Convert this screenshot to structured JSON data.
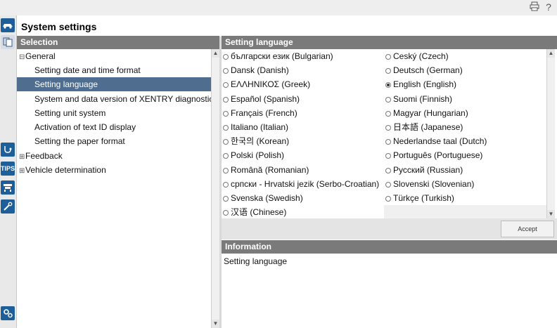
{
  "toolbar": {
    "print_icon": "printer-icon",
    "help_label": "?"
  },
  "rail": {
    "tips_label": "TIPS"
  },
  "page_title": "System settings",
  "selection": {
    "header": "Selection",
    "items": [
      {
        "label": "General",
        "expander": "⊟"
      },
      {
        "label": "Setting date and time format"
      },
      {
        "label": "Setting language"
      },
      {
        "label": "System and data version of XENTRY diagnostics"
      },
      {
        "label": "Setting unit system"
      },
      {
        "label": "Activation of text ID display"
      },
      {
        "label": "Setting the paper format"
      },
      {
        "label": "Feedback",
        "expander": "⊞"
      },
      {
        "label": "Vehicle determination",
        "expander": "⊞"
      }
    ]
  },
  "language": {
    "header": "Setting language",
    "left": [
      "български език (Bulgarian)",
      "Dansk (Danish)",
      "ΕΛΛΗΝΙΚΟΣ (Greek)",
      "Español (Spanish)",
      "Français (French)",
      "Italiano (Italian)",
      "한국의 (Korean)",
      "Polski (Polish)",
      "Română (Romanian)",
      "српски - Hrvatski jezik (Serbo-Croatian)",
      "Svenska (Swedish)",
      "汉语 (Chinese)"
    ],
    "right": [
      "Ceský (Czech)",
      "Deutsch (German)",
      "English (English)",
      "Suomi (Finnish)",
      "Magyar (Hungarian)",
      "日本語 (Japanese)",
      "Nederlandse taal (Dutch)",
      "Português (Portuguese)",
      "Русский (Russian)",
      "Slovenski (Slovenian)",
      "Türkçe (Turkish)"
    ],
    "selected": "English (English)",
    "accept_label": "Accept"
  },
  "information": {
    "header": "Information",
    "text": "Setting language"
  },
  "colors": {
    "selected_row": "#4e6d8f",
    "header_bg": "#7a7a7a",
    "rail_button": "#1f5f99"
  }
}
